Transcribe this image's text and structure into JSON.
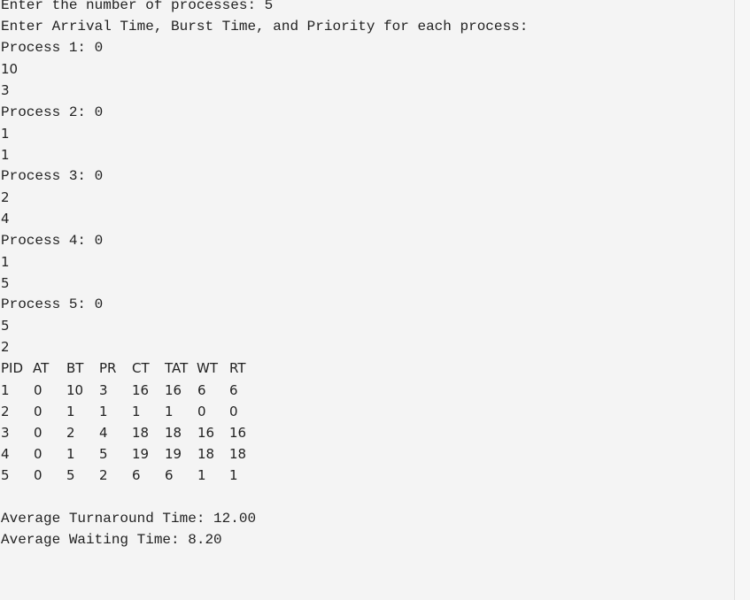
{
  "console": {
    "prompt_count": "Enter the number of processes: 5",
    "prompt_fields": "Enter Arrival Time, Burst Time, and Priority for each process:",
    "p1_label": "Process 1: 0",
    "p1_burst": "10",
    "p1_priority": "3",
    "p2_label": "Process 2: 0",
    "p2_burst": "1",
    "p2_priority": "1",
    "p3_label": "Process 3: 0",
    "p3_burst": "2",
    "p3_priority": "4",
    "p4_label": "Process 4: 0",
    "p4_burst": "1",
    "p4_priority": "5",
    "p5_label": "Process 5: 0",
    "p5_burst": "5",
    "p5_priority": "2"
  },
  "table": {
    "headers": [
      "PID",
      "AT",
      "BT",
      "PR",
      "CT",
      "TAT",
      "WT",
      "RT"
    ],
    "rows": [
      [
        "1",
        "0",
        "10",
        "3",
        "16",
        "16",
        "6",
        "6"
      ],
      [
        "2",
        "0",
        "1",
        "1",
        "1",
        "1",
        "0",
        "0"
      ],
      [
        "3",
        "0",
        "2",
        "4",
        "18",
        "18",
        "16",
        "16"
      ],
      [
        "4",
        "0",
        "1",
        "5",
        "19",
        "19",
        "18",
        "18"
      ],
      [
        "5",
        "0",
        "5",
        "2",
        "6",
        "6",
        "1",
        "1"
      ]
    ]
  },
  "summary": {
    "avg_tat": "Average Turnaround Time: 12.00",
    "avg_wt": "Average Waiting Time: 8.20"
  }
}
